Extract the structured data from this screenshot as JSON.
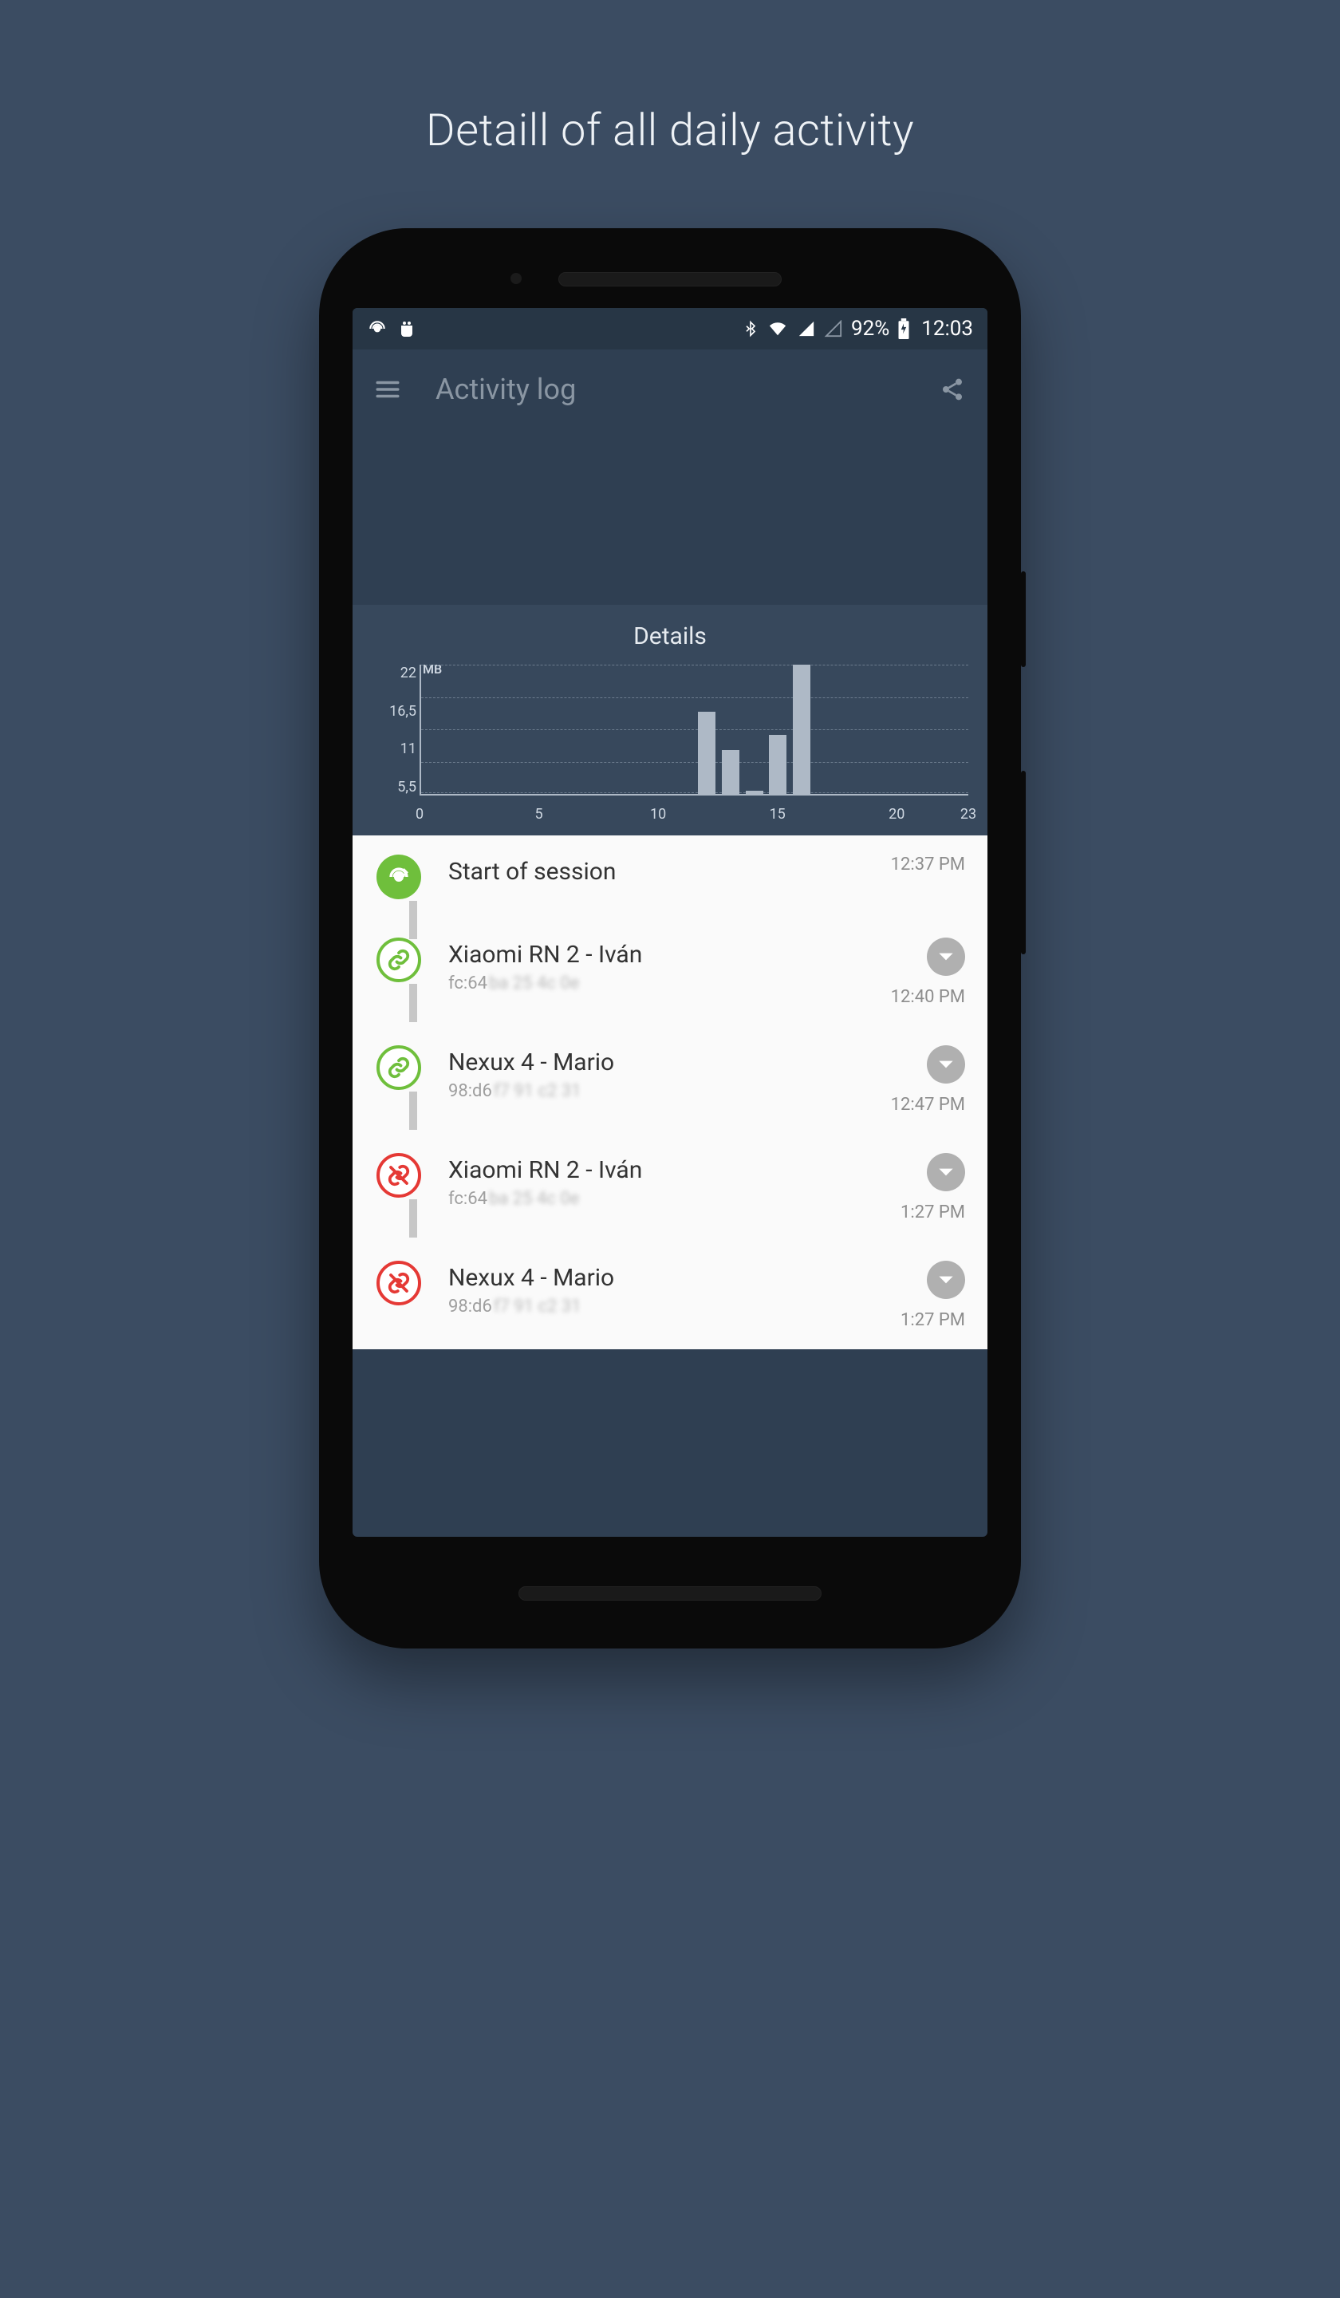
{
  "promo_title": "Detaill of all daily activity",
  "status": {
    "battery_pct": "92%",
    "clock": "12:03"
  },
  "appbar": {
    "title": "Activity log"
  },
  "chart": {
    "title": "Details",
    "unit": "MB"
  },
  "chart_data": {
    "type": "bar",
    "title": "Details",
    "ylabel": "MB",
    "xlabel": "",
    "x_range": [
      0,
      23
    ],
    "ylim": [
      0,
      22
    ],
    "y_ticks": [
      5.5,
      11,
      16.5,
      22
    ],
    "y_tick_labels": [
      "5,5",
      "11",
      "16,5",
      "22"
    ],
    "x_ticks": [
      0,
      5,
      10,
      15,
      20,
      23
    ],
    "categories": [
      12,
      13,
      14,
      15,
      16
    ],
    "values": [
      14,
      7.5,
      0.5,
      10,
      22
    ]
  },
  "log": [
    {
      "kind": "start",
      "title": "Start of session",
      "mac_clear": "",
      "mac_blur": "",
      "time": "12:37 PM"
    },
    {
      "kind": "connect",
      "title": "Xiaomi RN 2 - Iván",
      "mac_clear": "fc:64",
      "mac_blur": "ba 25 4c 0e",
      "time": "12:40 PM"
    },
    {
      "kind": "connect",
      "title": "Nexux 4 - Mario",
      "mac_clear": "98:d6",
      "mac_blur": "f7 91 c2 31",
      "time": "12:47 PM"
    },
    {
      "kind": "disconnect",
      "title": "Xiaomi RN 2 - Iván",
      "mac_clear": "fc:64",
      "mac_blur": "ba 25 4c 0e",
      "time": "1:27 PM"
    },
    {
      "kind": "disconnect",
      "title": "Nexux 4 - Mario",
      "mac_clear": "98:d6",
      "mac_blur": "f7 91 c2 31",
      "time": "1:27 PM"
    }
  ]
}
